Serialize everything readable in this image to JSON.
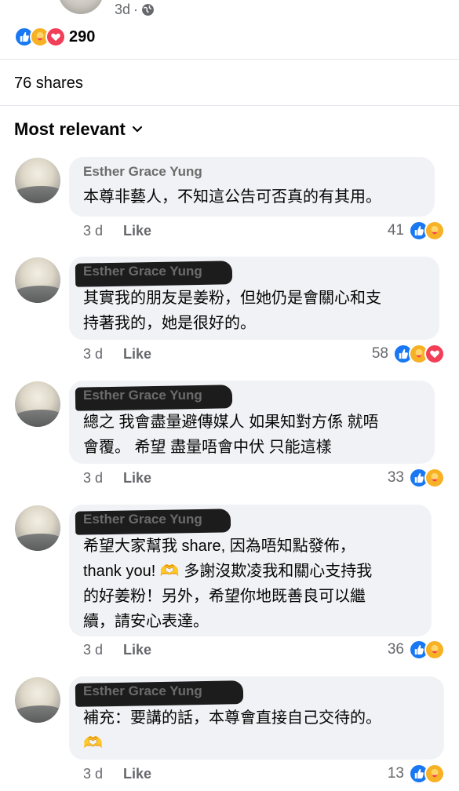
{
  "post": {
    "time": "3d",
    "dot": "·",
    "reaction_count": "290",
    "shares": "76 shares",
    "sort_label": "Most relevant"
  },
  "comments": [
    {
      "name": "Esther Grace Yung",
      "text": "本尊非藝人，不知這公告可否真的有其用。",
      "time": "3 d",
      "like_label": "Like",
      "reaction_count": "41",
      "reactions": [
        "like-icon",
        "care-icon"
      ]
    },
    {
      "name": "Esther Grace Yung",
      "text": "其實我的朋友是姜粉，但她仍是會關心和支\n持著我的，她是很好的。",
      "time": "3 d",
      "like_label": "Like",
      "reaction_count": "58",
      "reactions": [
        "like-icon",
        "care-icon",
        "love-icon"
      ]
    },
    {
      "name": "Esther Grace Yung",
      "text": "總之 我會盡量避傳媒人 如果知對方係 就唔\n會覆。 希望 盡量唔會中伏 只能這樣",
      "time": "3 d",
      "like_label": "Like",
      "reaction_count": "33",
      "reactions": [
        "like-icon",
        "care-icon"
      ]
    },
    {
      "name": "Esther Grace Yung",
      "text": "希望大家幫我 share, 因為唔知點發佈，\nthank you! 🫶 多謝沒欺凌我和關心支持我\n的好姜粉！另外，希望你地既善良可以繼\n續，請安心表達。",
      "time": "3 d",
      "like_label": "Like",
      "reaction_count": "36",
      "reactions": [
        "like-icon",
        "care-icon"
      ]
    },
    {
      "name": "Esther Grace Yung",
      "text": "補充：要講的話，本尊會直接自己交待的。\n🫶",
      "time": "3 d",
      "like_label": "Like",
      "reaction_count": "13",
      "reactions": [
        "like-icon",
        "care-icon"
      ]
    }
  ],
  "colors": {
    "like": "#1877f2",
    "care": "#f7b125",
    "love": "#f33e58",
    "bubble": "#f0f2f5",
    "meta_text": "#65676b"
  }
}
